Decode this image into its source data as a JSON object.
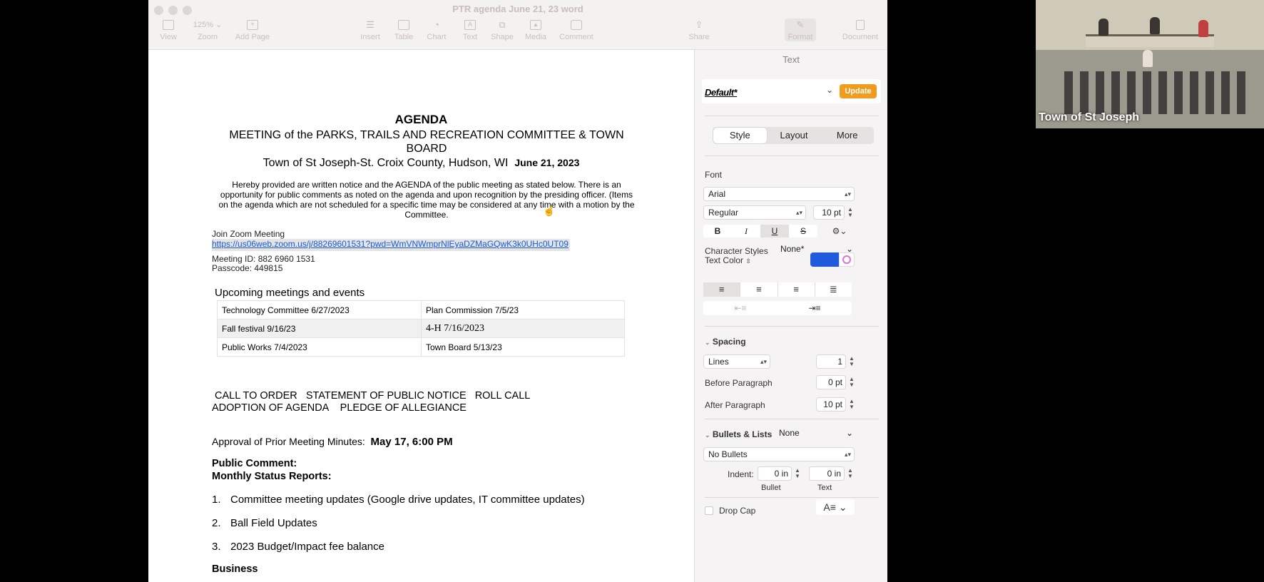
{
  "window": {
    "title": "PTR agenda June 21, 23 word",
    "zoom_value": "125%"
  },
  "toolbar": {
    "view": "View",
    "zoom": "Zoom",
    "add_page": "Add Page",
    "insert": "Insert",
    "table": "Table",
    "chart": "Chart",
    "text": "Text",
    "shape": "Shape",
    "media": "Media",
    "comment": "Comment",
    "share": "Share",
    "format": "Format",
    "document": "Document"
  },
  "document": {
    "agenda_title": "AGENDA",
    "meeting_line": "MEETING of the PARKS, TRAILS AND RECREATION COMMITTEE & TOWN BOARD",
    "town_line": "Town of St Joseph-St. Croix County, Hudson, WI",
    "date_bold": "June 21, 2023",
    "notice": "Hereby provided are written notice and the AGENDA of the public meeting as stated below. There is an opportunity for public comments as noted on the agenda and upon recognition by the presiding officer. (Items on the agenda which are not scheduled for a specific time may be considered at any time with a motion by the Committee.",
    "join_zoom": "Join Zoom Meeting",
    "zoom_link": "https://us06web.zoom.us/j/88269601531?pwd=WmVNWmprNlEyaDZMaGQwK3k0UHc0UT09",
    "meeting_id": "Meeting ID: 882 6960 1531",
    "passcode": "Passcode: 449815",
    "events_title": "Upcoming meetings and events",
    "events": [
      [
        "Technology Committee 6/27/2023",
        "Plan Commission 7/5/23"
      ],
      [
        "Fall festival 9/16/23",
        "4-H 7/16/2023"
      ],
      [
        "Public Works 7/4/2023",
        "Town Board 5/13/23"
      ]
    ],
    "call_line": "CALL TO ORDER   STATEMENT OF PUBLIC NOTICE   ROLL CALL",
    "adoption_line": "ADOPTION OF AGENDA    PLEDGE OF ALLEGIANCE",
    "approval_label": "Approval of Prior Meeting Minutes:",
    "approval_date": "May 17, 6:00 PM",
    "public_comment": "Public Comment:",
    "monthly_reports": "Monthly Status Reports:",
    "items": [
      {
        "num": "1.",
        "text": "Committee meeting updates (Google drive updates, IT committee updates)"
      },
      {
        "num": "2.",
        "text": "Ball Field Updates"
      },
      {
        "num": "3.",
        "text": "2023 Budget/Impact fee balance"
      }
    ],
    "business": "Business"
  },
  "sidebar": {
    "header": "Text",
    "paragraph_style": "Default*",
    "update": "Update",
    "tabs": [
      "Style",
      "Layout",
      "More"
    ],
    "font_label": "Font",
    "font_name": "Arial",
    "font_weight": "Regular",
    "font_size": "10 pt",
    "bold": "B",
    "italic": "I",
    "underline": "U",
    "strike": "S",
    "character_styles_label": "Character Styles",
    "character_styles_value": "None*",
    "text_color_label": "Text Color",
    "text_color": "#1f5bdc",
    "spacing_label": "Spacing",
    "spacing_mode": "Lines",
    "spacing_value": "1",
    "before_paragraph_label": "Before Paragraph",
    "before_paragraph_value": "0 pt",
    "after_paragraph_label": "After Paragraph",
    "after_paragraph_value": "10 pt",
    "bullets_label": "Bullets & Lists",
    "bullets_value": "None",
    "no_bullets": "No Bullets",
    "indent_label": "Indent:",
    "indent_bullet_value": "0 in",
    "indent_text_value": "0 in",
    "bullet_caption": "Bullet",
    "text_caption": "Text",
    "drop_cap_label": "Drop Cap"
  },
  "video": {
    "label": "Town of St Joseph"
  }
}
